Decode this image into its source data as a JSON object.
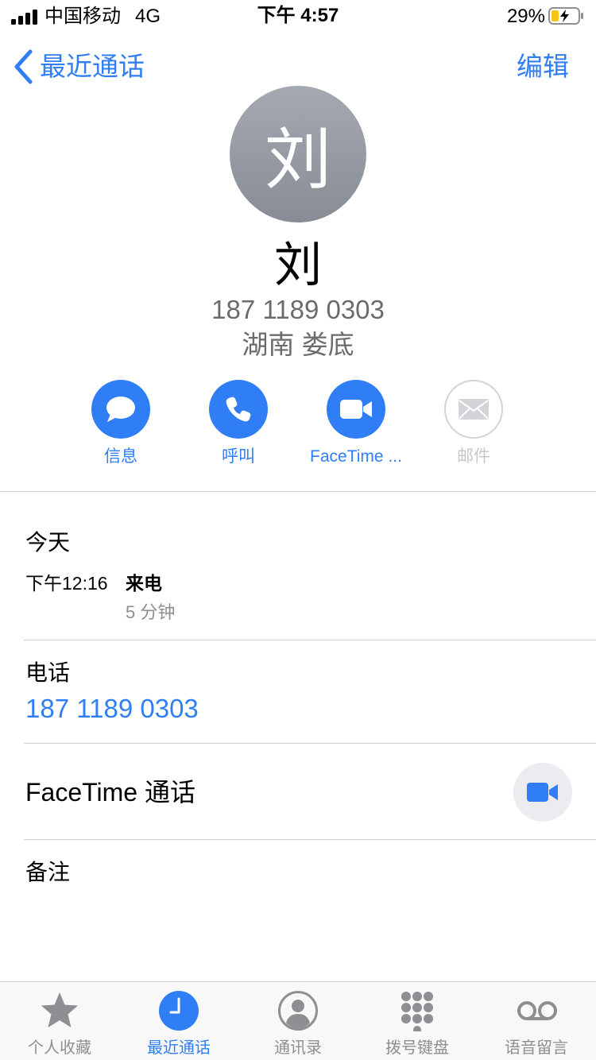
{
  "status_bar": {
    "carrier": "中国移动",
    "network": "4G",
    "time": "下午 4:57",
    "battery": "29%"
  },
  "nav": {
    "back_label": "最近通话",
    "edit_label": "编辑"
  },
  "contact": {
    "avatar_initial": "刘",
    "name": "刘",
    "number": "187 1189 0303",
    "location": "湖南 娄底"
  },
  "actions": [
    {
      "label": "信息",
      "icon": "message-icon",
      "enabled": true
    },
    {
      "label": "呼叫",
      "icon": "phone-icon",
      "enabled": true
    },
    {
      "label": "FaceTime ...",
      "icon": "video-icon",
      "enabled": true
    },
    {
      "label": "邮件",
      "icon": "mail-icon",
      "enabled": false
    }
  ],
  "recent": {
    "title": "今天",
    "call": {
      "time": "下午12:16",
      "type": "来电",
      "duration": "5 分钟"
    }
  },
  "phone": {
    "title": "电话",
    "value": "187 1189 0303"
  },
  "facetime": {
    "label": "FaceTime 通话"
  },
  "notes": {
    "title": "备注"
  },
  "tabs": [
    {
      "label": "个人收藏",
      "icon": "star-icon",
      "active": false
    },
    {
      "label": "最近通话",
      "icon": "clock-icon",
      "active": true
    },
    {
      "label": "通讯录",
      "icon": "contacts-icon",
      "active": false
    },
    {
      "label": "拨号键盘",
      "icon": "keypad-icon",
      "active": false
    },
    {
      "label": "语音留言",
      "icon": "voicemail-icon",
      "active": false
    }
  ],
  "colors": {
    "accent": "#2f7ef6",
    "secondary_text": "#6b6b6b",
    "tab_inactive": "#8e8e93",
    "battery_fill": "#f5c518"
  }
}
